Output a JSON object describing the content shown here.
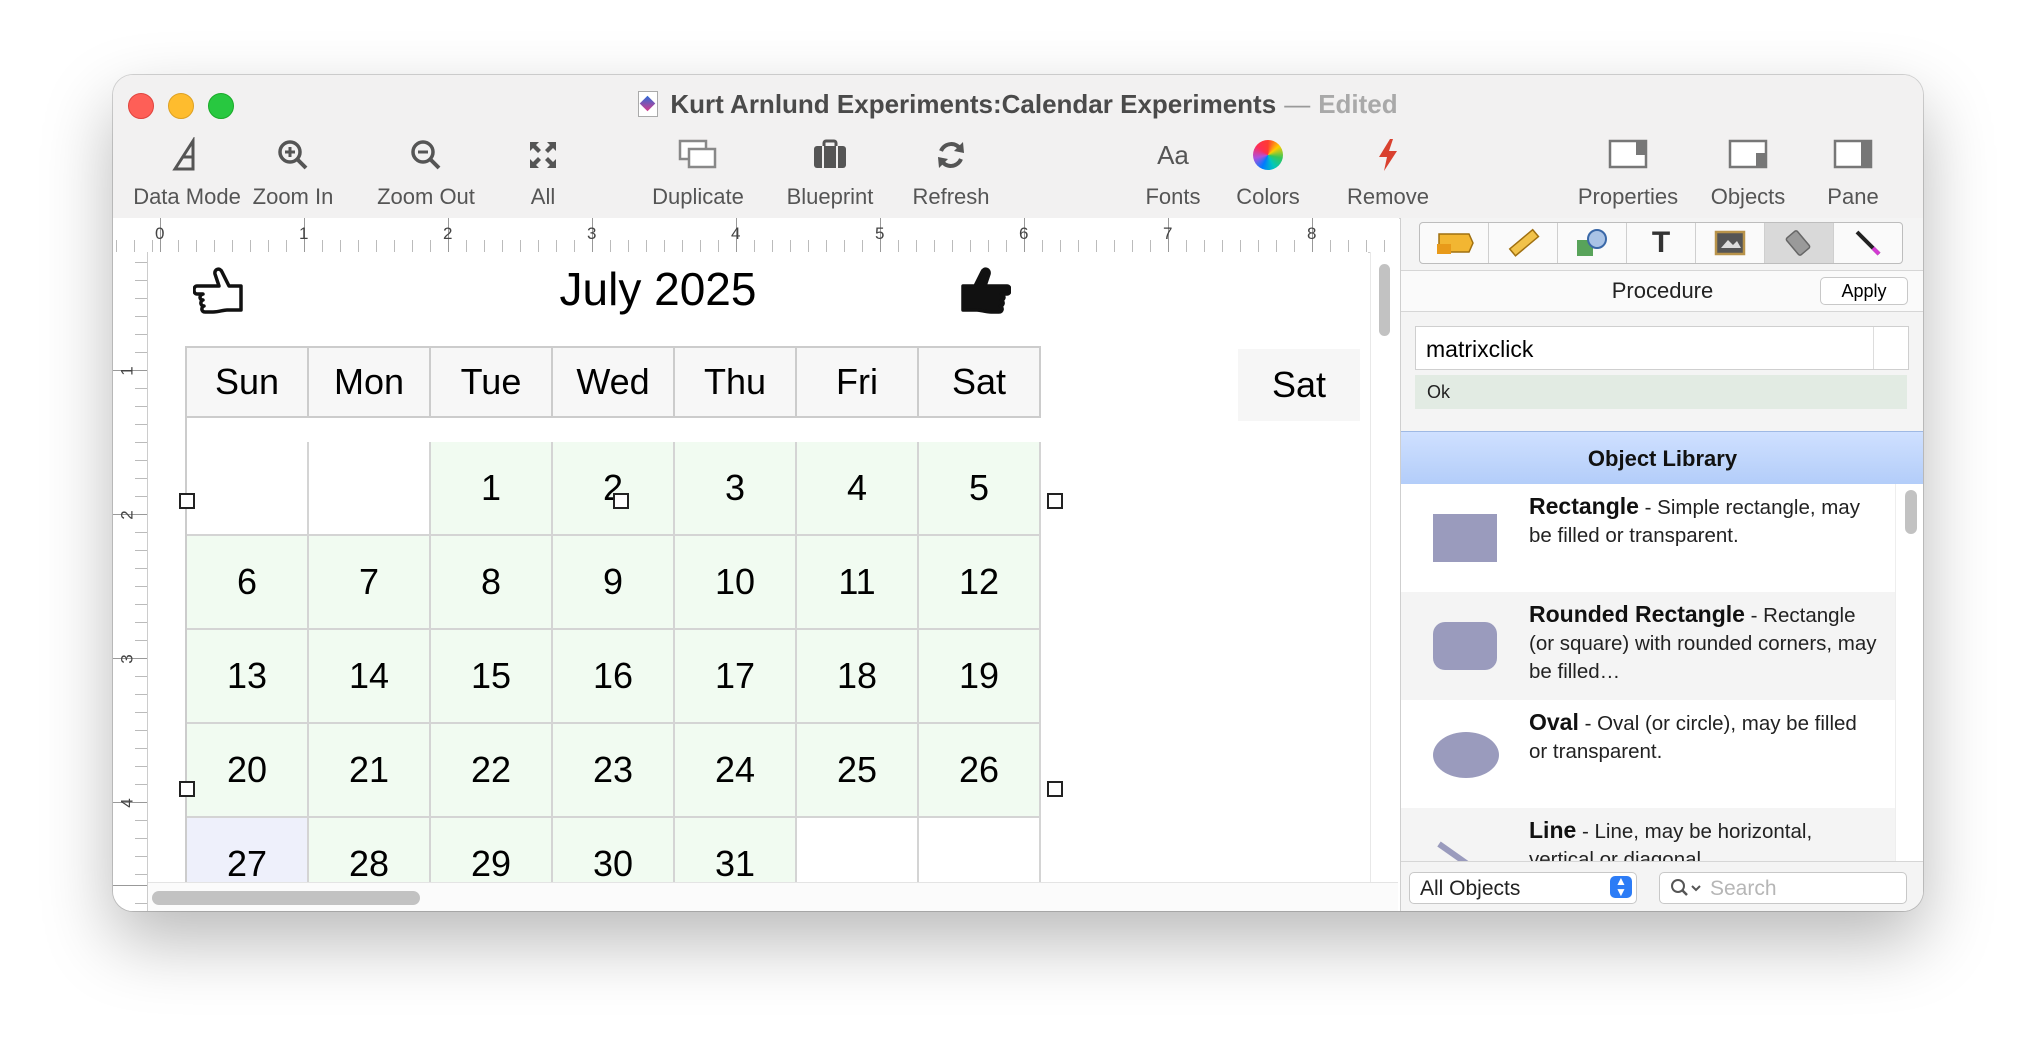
{
  "window": {
    "title": "Kurt Arnlund Experiments:Calendar Experiments",
    "separator": "—",
    "status": "Edited"
  },
  "toolbar": {
    "data_mode": "Data Mode",
    "zoom_in": "Zoom In",
    "zoom_out": "Zoom Out",
    "all": "All",
    "duplicate": "Duplicate",
    "blueprint": "Blueprint",
    "refresh": "Refresh",
    "fonts": "Fonts",
    "fonts_glyph": "Aa",
    "colors": "Colors",
    "remove": "Remove",
    "properties": "Properties",
    "objects": "Objects",
    "pane": "Pane"
  },
  "ruler": {
    "h_labels": [
      "0",
      "1",
      "2",
      "3",
      "4",
      "5",
      "6",
      "7",
      "8"
    ],
    "v_labels": [
      "1",
      "2",
      "3",
      "4"
    ]
  },
  "calendar": {
    "title": "July 2025",
    "day_headers": [
      "Sun",
      "Mon",
      "Tue",
      "Wed",
      "Thu",
      "Fri",
      "Sat"
    ],
    "weeks": [
      [
        "",
        "",
        "1",
        "2",
        "3",
        "4",
        "5"
      ],
      [
        "6",
        "7",
        "8",
        "9",
        "10",
        "11",
        "12"
      ],
      [
        "13",
        "14",
        "15",
        "16",
        "17",
        "18",
        "19"
      ],
      [
        "20",
        "21",
        "22",
        "23",
        "24",
        "25",
        "26"
      ],
      [
        "27",
        "28",
        "29",
        "30",
        "31",
        "",
        ""
      ]
    ],
    "side_label": "Sat"
  },
  "pane": {
    "tab_text_glyph": "T",
    "procedure_label": "Procedure",
    "apply_label": "Apply",
    "procedure_value": "matrixclick",
    "status": "Ok",
    "library_title": "Object Library",
    "library_items": [
      {
        "name": "Rectangle",
        "desc": " - Simple rectangle, may be filled or transparent."
      },
      {
        "name": "Rounded Rectangle",
        "desc": " - Rectangle (or square) with rounded corners, may be filled…"
      },
      {
        "name": "Oval",
        "desc": " - Oval (or circle), may be filled or transparent."
      },
      {
        "name": "Line",
        "desc": " - Line, may be horizontal, vertical or diagonal."
      }
    ],
    "filter_value": "All Objects",
    "search_placeholder": "Search"
  },
  "colors": {
    "calendar_cell": "#f1fbf1",
    "today_cell": "#eef0fb",
    "library_header": "#b3cdf9",
    "shape_fill": "#9a9bbd"
  }
}
